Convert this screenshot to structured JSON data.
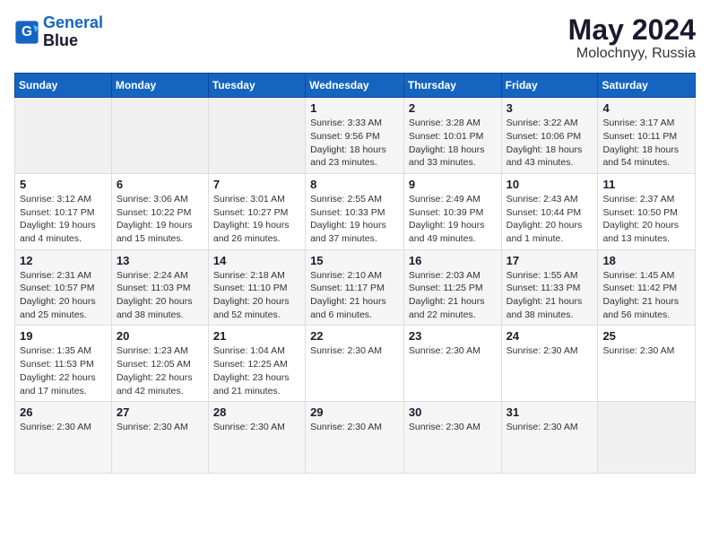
{
  "header": {
    "logo_line1": "General",
    "logo_line2": "Blue",
    "month_year": "May 2024",
    "location": "Molochnyy, Russia"
  },
  "weekdays": [
    "Sunday",
    "Monday",
    "Tuesday",
    "Wednesday",
    "Thursday",
    "Friday",
    "Saturday"
  ],
  "weeks": [
    [
      {
        "day": "",
        "info": ""
      },
      {
        "day": "",
        "info": ""
      },
      {
        "day": "",
        "info": ""
      },
      {
        "day": "1",
        "info": "Sunrise: 3:33 AM\nSunset: 9:56 PM\nDaylight: 18 hours\nand 23 minutes."
      },
      {
        "day": "2",
        "info": "Sunrise: 3:28 AM\nSunset: 10:01 PM\nDaylight: 18 hours\nand 33 minutes."
      },
      {
        "day": "3",
        "info": "Sunrise: 3:22 AM\nSunset: 10:06 PM\nDaylight: 18 hours\nand 43 minutes."
      },
      {
        "day": "4",
        "info": "Sunrise: 3:17 AM\nSunset: 10:11 PM\nDaylight: 18 hours\nand 54 minutes."
      }
    ],
    [
      {
        "day": "5",
        "info": "Sunrise: 3:12 AM\nSunset: 10:17 PM\nDaylight: 19 hours\nand 4 minutes."
      },
      {
        "day": "6",
        "info": "Sunrise: 3:06 AM\nSunset: 10:22 PM\nDaylight: 19 hours\nand 15 minutes."
      },
      {
        "day": "7",
        "info": "Sunrise: 3:01 AM\nSunset: 10:27 PM\nDaylight: 19 hours\nand 26 minutes."
      },
      {
        "day": "8",
        "info": "Sunrise: 2:55 AM\nSunset: 10:33 PM\nDaylight: 19 hours\nand 37 minutes."
      },
      {
        "day": "9",
        "info": "Sunrise: 2:49 AM\nSunset: 10:39 PM\nDaylight: 19 hours\nand 49 minutes."
      },
      {
        "day": "10",
        "info": "Sunrise: 2:43 AM\nSunset: 10:44 PM\nDaylight: 20 hours\nand 1 minute."
      },
      {
        "day": "11",
        "info": "Sunrise: 2:37 AM\nSunset: 10:50 PM\nDaylight: 20 hours\nand 13 minutes."
      }
    ],
    [
      {
        "day": "12",
        "info": "Sunrise: 2:31 AM\nSunset: 10:57 PM\nDaylight: 20 hours\nand 25 minutes."
      },
      {
        "day": "13",
        "info": "Sunrise: 2:24 AM\nSunset: 11:03 PM\nDaylight: 20 hours\nand 38 minutes."
      },
      {
        "day": "14",
        "info": "Sunrise: 2:18 AM\nSunset: 11:10 PM\nDaylight: 20 hours\nand 52 minutes."
      },
      {
        "day": "15",
        "info": "Sunrise: 2:10 AM\nSunset: 11:17 PM\nDaylight: 21 hours\nand 6 minutes."
      },
      {
        "day": "16",
        "info": "Sunrise: 2:03 AM\nSunset: 11:25 PM\nDaylight: 21 hours\nand 22 minutes."
      },
      {
        "day": "17",
        "info": "Sunrise: 1:55 AM\nSunset: 11:33 PM\nDaylight: 21 hours\nand 38 minutes."
      },
      {
        "day": "18",
        "info": "Sunrise: 1:45 AM\nSunset: 11:42 PM\nDaylight: 21 hours\nand 56 minutes."
      }
    ],
    [
      {
        "day": "19",
        "info": "Sunrise: 1:35 AM\nSunset: 11:53 PM\nDaylight: 22 hours\nand 17 minutes."
      },
      {
        "day": "20",
        "info": "Sunrise: 1:23 AM\nSunset: 12:05 AM\nDaylight: 22 hours\nand 42 minutes."
      },
      {
        "day": "21",
        "info": "Sunrise: 1:04 AM\nSunset: 12:25 AM\nDaylight: 23 hours\nand 21 minutes."
      },
      {
        "day": "22",
        "info": "Sunrise: 2:30 AM"
      },
      {
        "day": "23",
        "info": "Sunrise: 2:30 AM"
      },
      {
        "day": "24",
        "info": "Sunrise: 2:30 AM"
      },
      {
        "day": "25",
        "info": "Sunrise: 2:30 AM"
      }
    ],
    [
      {
        "day": "26",
        "info": "Sunrise: 2:30 AM"
      },
      {
        "day": "27",
        "info": "Sunrise: 2:30 AM"
      },
      {
        "day": "28",
        "info": "Sunrise: 2:30 AM"
      },
      {
        "day": "29",
        "info": "Sunrise: 2:30 AM"
      },
      {
        "day": "30",
        "info": "Sunrise: 2:30 AM"
      },
      {
        "day": "31",
        "info": "Sunrise: 2:30 AM"
      },
      {
        "day": "",
        "info": ""
      }
    ]
  ]
}
